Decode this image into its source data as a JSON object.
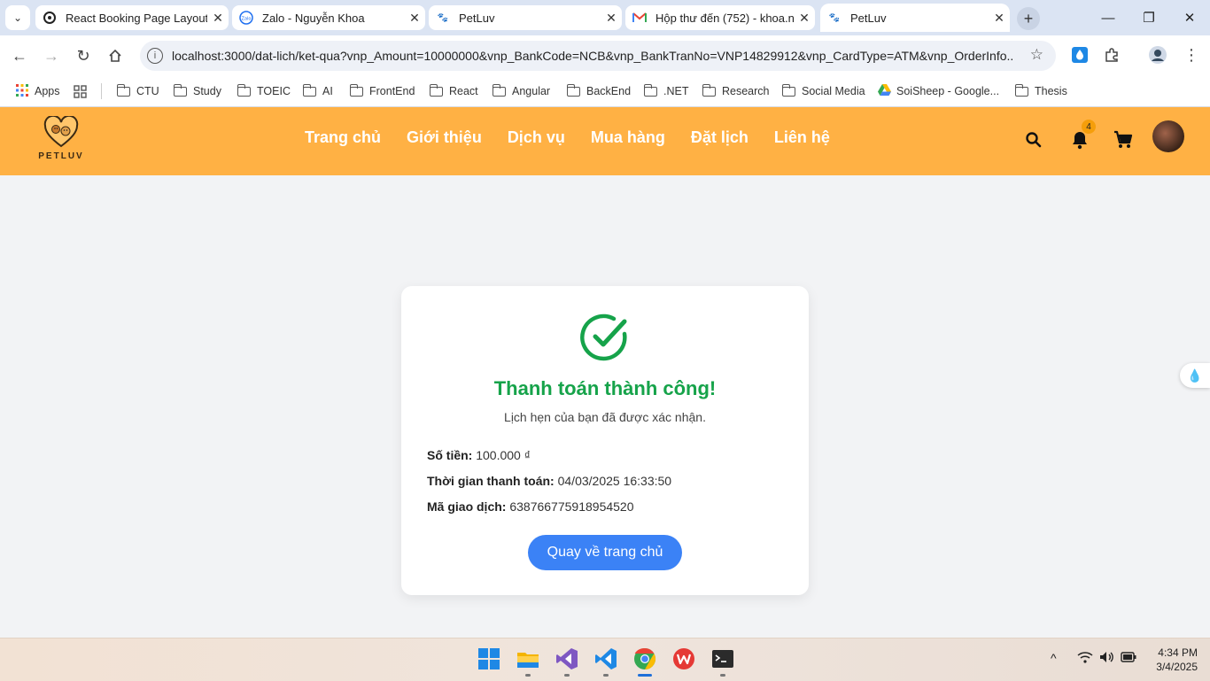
{
  "browser": {
    "tabs": [
      {
        "label": "React Booking Page Layout",
        "icon": "openai-icon"
      },
      {
        "label": "Zalo - Nguyễn Khoa",
        "icon": "zalo-icon"
      },
      {
        "label": "PetLuv",
        "icon": "petluv-icon"
      },
      {
        "label": "Hộp thư đến (752) - khoa.np",
        "icon": "gmail-icon"
      },
      {
        "label": "PetLuv",
        "icon": "petluv-icon"
      }
    ],
    "url": "localhost:3000/dat-lich/ket-qua?vnp_Amount=10000000&vnp_BankCode=NCB&vnp_BankTranNo=VNP14829912&vnp_CardType=ATM&vnp_OrderInfo...",
    "bookmarks": [
      "Apps",
      "CTU",
      "Study",
      "TOEIC",
      "AI",
      "FrontEnd",
      "React",
      "Angular",
      "BackEnd",
      ".NET",
      "Research",
      "Social Media",
      "SoiSheep - Google...",
      "Thesis"
    ]
  },
  "site": {
    "logo_text": "PETLUV",
    "nav": [
      "Trang chủ",
      "Giới thiệu",
      "Dịch vụ",
      "Mua hàng",
      "Đặt lịch",
      "Liên hệ"
    ],
    "notification_count": "4",
    "brand_color": "#ffb144"
  },
  "result": {
    "title": "Thanh toán thành công!",
    "subtitle": "Lịch hẹn của bạn đã được xác nhận.",
    "amount_label": "Số tiền:",
    "amount_value": "100.000 ₫",
    "time_label": "Thời gian thanh toán:",
    "time_value": "04/03/2025 16:33:50",
    "txn_label": "Mã giao dịch:",
    "txn_value": "638766775918954520",
    "home_button": "Quay về trang chủ",
    "success_color": "#16a34a",
    "button_color": "#3b82f6"
  },
  "taskbar": {
    "time": "4:34 PM",
    "date": "3/4/2025"
  }
}
